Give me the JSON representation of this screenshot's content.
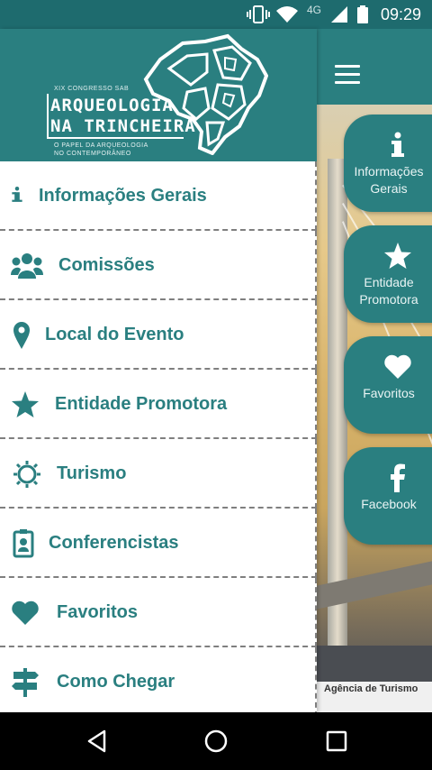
{
  "status_bar": {
    "network": "4G",
    "time": "09:29",
    "icons": [
      "vibrate-icon",
      "wifi-icon",
      "signal-icon",
      "battery-icon"
    ]
  },
  "drawer": {
    "header": {
      "congress": "XIX CONGRESSO SAB",
      "title_line1": "ARQUEOLOGIA",
      "title_line2": "NA TRINCHEIRA",
      "subtitle_line1": "O PAPEL DA ARQUEOLOGIA",
      "subtitle_line2": "NO CONTEMPORÂNEO"
    },
    "items": [
      {
        "label": "Informações Gerais",
        "icon": "info-icon"
      },
      {
        "label": "Comissões",
        "icon": "users-icon"
      },
      {
        "label": "Local do Evento",
        "icon": "map-pin-icon"
      },
      {
        "label": "Entidade Promotora",
        "icon": "star-icon"
      },
      {
        "label": "Turismo",
        "icon": "sun-icon"
      },
      {
        "label": "Conferencistas",
        "icon": "id-badge-icon"
      },
      {
        "label": "Favoritos",
        "icon": "heart-icon"
      },
      {
        "label": "Como Chegar",
        "icon": "signpost-icon"
      }
    ]
  },
  "main": {
    "fabs": [
      {
        "label": "Informações Gerais",
        "icon": "info-icon"
      },
      {
        "label": "Entidade Promotora",
        "icon": "star-icon"
      },
      {
        "label": "Favoritos",
        "icon": "heart-icon"
      },
      {
        "label": "Facebook",
        "icon": "facebook-icon"
      }
    ],
    "caption": "Agência de Turismo"
  },
  "colors": {
    "primary": "#2a7f80",
    "status_bar": "#1e6b6e",
    "nav_bar": "#000000",
    "divider": "#7f7f7f"
  }
}
